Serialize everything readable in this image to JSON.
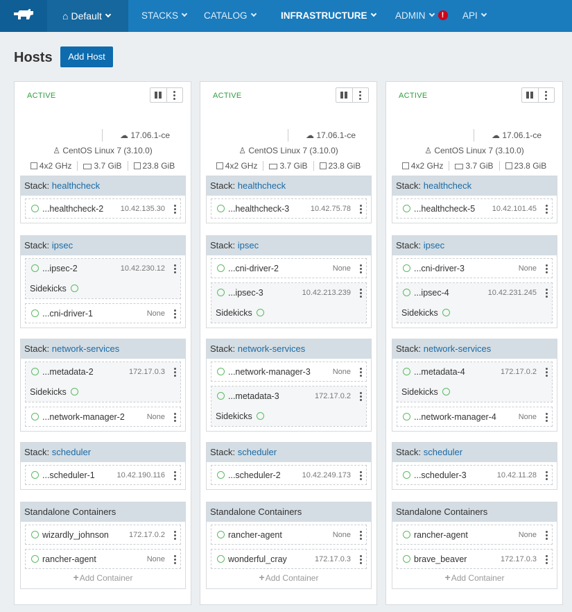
{
  "nav": {
    "env": "Default",
    "items": {
      "stacks": "STACKS",
      "catalog": "CATALOG",
      "infrastructure": "INFRASTRUCTURE",
      "admin": "ADMIN",
      "api": "API"
    },
    "alert": "!"
  },
  "page": {
    "title": "Hosts",
    "add_host": "Add Host",
    "sidekicks": "Sidekicks",
    "stack_prefix": "Stack: ",
    "standalone": "Standalone Containers",
    "add_container": "Add Container"
  },
  "hosts": [
    {
      "state": "ACTIVE",
      "docker": "17.06.1-ce",
      "os": "CentOS Linux 7 (3.10.0)",
      "cpu": "4x2 GHz",
      "ram": "3.7 GiB",
      "disk": "23.8 GiB",
      "stacks": {
        "healthcheck": {
          "name": "healthcheck",
          "c1": {
            "name": "...healthcheck-2",
            "ip": "10.42.135.30"
          }
        },
        "ipsec": {
          "name": "ipsec",
          "c1": {
            "name": "...ipsec-2",
            "ip": "10.42.230.12"
          },
          "c2": {
            "name": "...cni-driver-1",
            "ip": "None"
          }
        },
        "network": {
          "name": "network-services",
          "c1": {
            "name": "...metadata-2",
            "ip": "172.17.0.3"
          },
          "c2": {
            "name": "...network-manager-2",
            "ip": "None"
          }
        },
        "scheduler": {
          "name": "scheduler",
          "c1": {
            "name": "...scheduler-1",
            "ip": "10.42.190.116"
          }
        },
        "standalone": {
          "c1": {
            "name": "wizardly_johnson",
            "ip": "172.17.0.2"
          },
          "c2": {
            "name": "rancher-agent",
            "ip": "None"
          }
        }
      }
    },
    {
      "state": "ACTIVE",
      "docker": "17.06.1-ce",
      "os": "CentOS Linux 7 (3.10.0)",
      "cpu": "4x2 GHz",
      "ram": "3.7 GiB",
      "disk": "23.8 GiB",
      "stacks": {
        "healthcheck": {
          "name": "healthcheck",
          "c1": {
            "name": "...healthcheck-3",
            "ip": "10.42.75.78"
          }
        },
        "ipsec": {
          "name": "ipsec",
          "c1": {
            "name": "...cni-driver-2",
            "ip": "None"
          },
          "c2": {
            "name": "...ipsec-3",
            "ip": "10.42.213.239"
          }
        },
        "network": {
          "name": "network-services",
          "c1": {
            "name": "...network-manager-3",
            "ip": "None"
          },
          "c2": {
            "name": "...metadata-3",
            "ip": "172.17.0.2"
          }
        },
        "scheduler": {
          "name": "scheduler",
          "c1": {
            "name": "...scheduler-2",
            "ip": "10.42.249.173"
          }
        },
        "standalone": {
          "c1": {
            "name": "rancher-agent",
            "ip": "None"
          },
          "c2": {
            "name": "wonderful_cray",
            "ip": "172.17.0.3"
          }
        }
      }
    },
    {
      "state": "ACTIVE",
      "docker": "17.06.1-ce",
      "os": "CentOS Linux 7 (3.10.0)",
      "cpu": "4x2 GHz",
      "ram": "3.7 GiB",
      "disk": "23.8 GiB",
      "stacks": {
        "healthcheck": {
          "name": "healthcheck",
          "c1": {
            "name": "...healthcheck-5",
            "ip": "10.42.101.45"
          }
        },
        "ipsec": {
          "name": "ipsec",
          "c1": {
            "name": "...cni-driver-3",
            "ip": "None"
          },
          "c2": {
            "name": "...ipsec-4",
            "ip": "10.42.231.245"
          }
        },
        "network": {
          "name": "network-services",
          "c1": {
            "name": "...metadata-4",
            "ip": "172.17.0.2"
          },
          "c2": {
            "name": "...network-manager-4",
            "ip": "None"
          }
        },
        "scheduler": {
          "name": "scheduler",
          "c1": {
            "name": "...scheduler-3",
            "ip": "10.42.11.28"
          }
        },
        "standalone": {
          "c1": {
            "name": "rancher-agent",
            "ip": "None"
          },
          "c2": {
            "name": "brave_beaver",
            "ip": "172.17.0.3"
          }
        }
      }
    }
  ],
  "colors": {
    "nav": "#1a7bbd",
    "active": "#2e9d3c",
    "stack_header": "#d4dde3",
    "link": "#1a6aa6"
  }
}
